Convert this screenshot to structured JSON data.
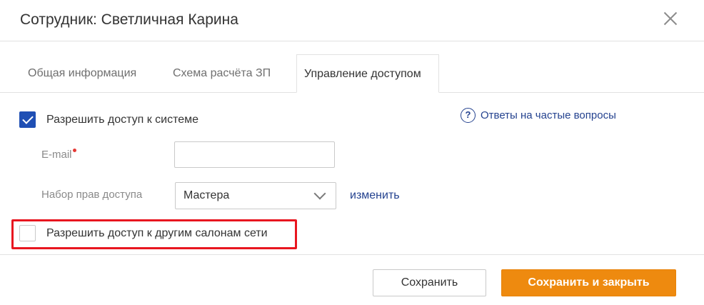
{
  "dialog": {
    "title": "Сотрудник: Светличная Карина",
    "close_icon": "close-icon"
  },
  "tabs": [
    {
      "label": "Общая информация",
      "active": false
    },
    {
      "label": "Схема расчёта ЗП",
      "active": false
    },
    {
      "label": "Управление доступом",
      "active": true
    }
  ],
  "access": {
    "allow_system_access": {
      "label": "Разрешить доступ к системе",
      "checked": true
    },
    "faq": {
      "icon": "question-circle-icon",
      "label": "Ответы на частые вопросы"
    },
    "email": {
      "label": "E-mail",
      "required": true,
      "value": "",
      "placeholder": ""
    },
    "permission_set": {
      "label": "Набор прав доступа",
      "selected": "Мастера"
    },
    "change_link": "изменить",
    "allow_other_salons": {
      "label": "Разрешить доступ к другим салонам сети",
      "checked": false,
      "highlighted": true
    }
  },
  "footer": {
    "save_label": "Сохранить",
    "save_close_label": "Сохранить и закрыть"
  },
  "colors": {
    "accent_blue": "#1f4fb4",
    "link_blue": "#24428f",
    "primary_orange": "#ee8a0f",
    "highlight_red": "#e8161f"
  }
}
